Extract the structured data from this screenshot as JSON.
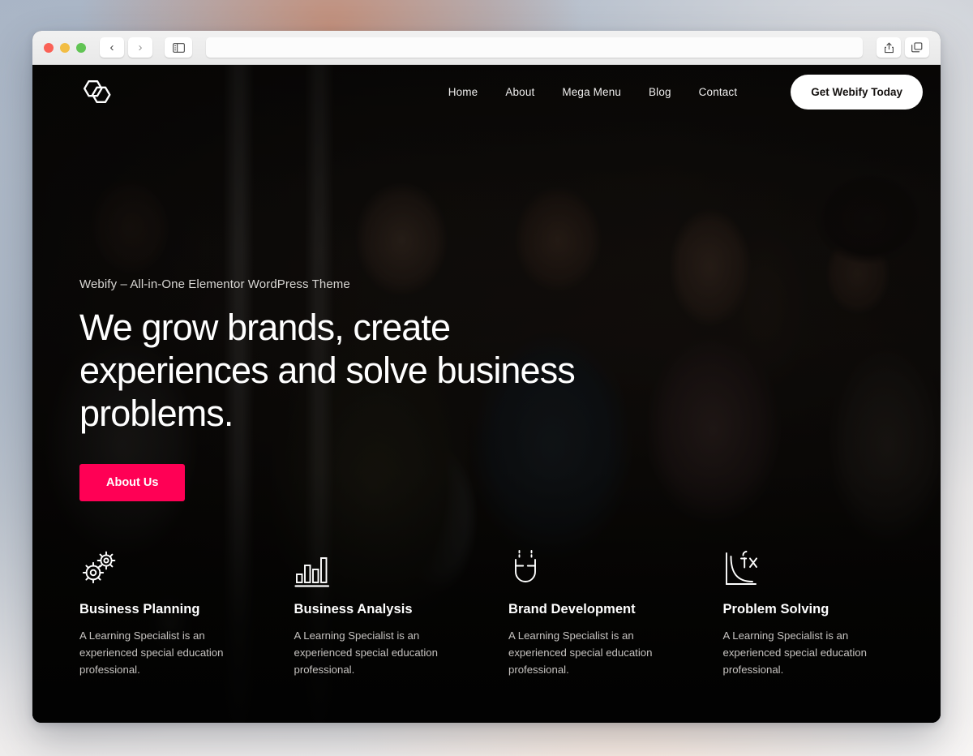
{
  "browser": {
    "traffic_lights": [
      "close",
      "minimize",
      "maximize"
    ],
    "back_label": "‹",
    "forward_label": "›",
    "sidebar_icon": "sidebar-icon",
    "share_icon": "share-icon",
    "tabs_icon": "tabs-overview-icon",
    "address_value": "",
    "address_placeholder": ""
  },
  "site": {
    "logo_name": "webify-hexagon-logo",
    "nav": [
      {
        "label": "Home"
      },
      {
        "label": "About"
      },
      {
        "label": "Mega Menu"
      },
      {
        "label": "Blog"
      },
      {
        "label": "Contact"
      }
    ],
    "cta": {
      "label": "Get Webify Today"
    },
    "hero": {
      "eyebrow": "Webify – All-in-One Elementor WordPress Theme",
      "title": "We grow brands, create experiences and solve business problems.",
      "button_label": "About Us",
      "button_color": "#ff0055"
    },
    "features": [
      {
        "icon": "gears-icon",
        "title": "Business Planning",
        "desc": "A Learning Specialist is an experienced special education professional."
      },
      {
        "icon": "bar-chart-icon",
        "title": "Business Analysis",
        "desc": "A Learning Specialist is an experienced special education professional."
      },
      {
        "icon": "magnet-icon",
        "title": "Brand Development",
        "desc": "A Learning Specialist is an experienced special education professional."
      },
      {
        "icon": "function-curve-fx-icon",
        "title": "Problem Solving",
        "desc": "A Learning Specialist is an experienced special education professional."
      }
    ]
  }
}
